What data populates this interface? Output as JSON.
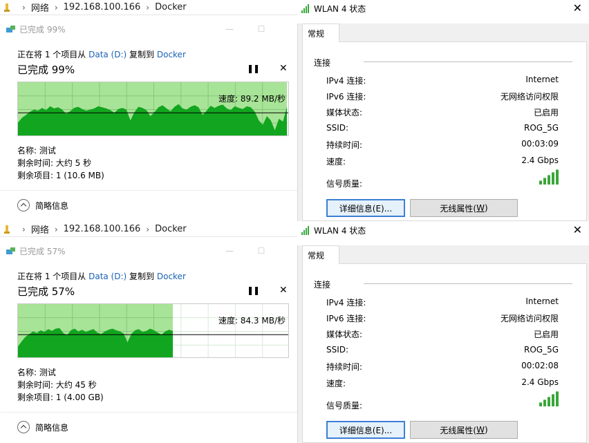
{
  "panes": [
    {
      "explorer": {
        "breadcrumb": [
          "网络",
          "192.168.100.166",
          "Docker"
        ],
        "sep": "›"
      },
      "copy": {
        "title": "已完成 99%",
        "line1_prefix": "正在将 1 个项目从 ",
        "line1_source": "Data (D:)",
        "line1_mid": " 复制到 ",
        "line1_dest": "Docker",
        "percent_text": "已完成 99%",
        "progress": 0.99,
        "pause_glyph": "❚❚",
        "close_glyph": "✕",
        "speed": "速度: 89.2 MB/秒",
        "speed_line_frac": 0.44,
        "name": "名称: 测试",
        "time_left": "剩余时间: 大约 5 秒",
        "items_left": "剩余项目: 1 (10.6 MB)",
        "less_info": "简略信息",
        "throughput": [
          0.26,
          0.35,
          0.4,
          0.46,
          0.5,
          0.48,
          0.53,
          0.49,
          0.56,
          0.52,
          0.54,
          0.5,
          0.42,
          0.47,
          0.53,
          0.55,
          0.51,
          0.48,
          0.5,
          0.52,
          0.56,
          0.54,
          0.52,
          0.49,
          0.44,
          0.51,
          0.53,
          0.5,
          0.3,
          0.45,
          0.55,
          0.53,
          0.49,
          0.38,
          0.45,
          0.54,
          0.58,
          0.52,
          0.47,
          0.55,
          0.6,
          0.52,
          0.5,
          0.55,
          0.58,
          0.54,
          0.4,
          0.48,
          0.57,
          0.53,
          0.57,
          0.59,
          0.52,
          0.49,
          0.56,
          0.53,
          0.51,
          0.56,
          0.54,
          0.46,
          0.3,
          0.22,
          0.38,
          0.3,
          0.12,
          0.33,
          0.28,
          0.55
        ]
      }
    },
    {
      "explorer": {
        "breadcrumb": [
          "网络",
          "192.168.100.166",
          "Docker"
        ],
        "sep": "›"
      },
      "copy": {
        "title": "已完成 57%",
        "line1_prefix": "正在将 1 个项目从 ",
        "line1_source": "Data (D:)",
        "line1_mid": " 复制到 ",
        "line1_dest": "Docker",
        "percent_text": "已完成 57%",
        "progress": 0.57,
        "pause_glyph": "❚❚",
        "close_glyph": "✕",
        "speed": "速度: 84.3 MB/秒",
        "speed_line_frac": 0.44,
        "name": "名称: 测试",
        "time_left": "剩余时间: 大约 45 秒",
        "items_left": "剩余项目: 1 (4.00 GB)",
        "less_info": "简略信息",
        "throughput": [
          0.22,
          0.32,
          0.4,
          0.45,
          0.5,
          0.47,
          0.52,
          0.49,
          0.54,
          0.51,
          0.55,
          0.56,
          0.47,
          0.43,
          0.52,
          0.55,
          0.5,
          0.53,
          0.49,
          0.52,
          0.54,
          0.48,
          0.45,
          0.5,
          0.53,
          0.55,
          0.52,
          0.5,
          0.46,
          0.3,
          0.45,
          0.52,
          0.54,
          0.49,
          0.51,
          0.55,
          0.52,
          0.48,
          0.44,
          0.5,
          0.53,
          0.51
        ]
      }
    }
  ],
  "wlan": [
    {
      "title": "WLAN 4 状态",
      "close_glyph": "✕",
      "tab": "常规",
      "group": "连接",
      "rows": [
        {
          "label": "IPv4 连接:",
          "value": "Internet"
        },
        {
          "label": "IPv6 连接:",
          "value": "无网络访问权限"
        },
        {
          "label": "媒体状态:",
          "value": "已启用"
        },
        {
          "label": "SSID:",
          "value": "ROG_5G"
        },
        {
          "label": "持续时间:",
          "value": "00:03:09"
        },
        {
          "label": "速度:",
          "value": "2.4 Gbps"
        }
      ],
      "signal_label": "信号质量:",
      "signal_bars": 5,
      "details_button": "详细信息(E)...",
      "wireless_button_main": "无线属性(",
      "wireless_button_key": "W",
      "wireless_button_end": ")",
      "colors": {
        "accent": "#3c7fd3",
        "signal": "#3aa63a"
      }
    },
    {
      "title": "WLAN 4 状态",
      "close_glyph": "✕",
      "tab": "常规",
      "group": "连接",
      "rows": [
        {
          "label": "IPv4 连接:",
          "value": "Internet"
        },
        {
          "label": "IPv6 连接:",
          "value": "无网络访问权限"
        },
        {
          "label": "媒体状态:",
          "value": "已启用"
        },
        {
          "label": "SSID:",
          "value": "ROG_5G"
        },
        {
          "label": "持续时间:",
          "value": "00:02:08"
        },
        {
          "label": "速度:",
          "value": "2.4 Gbps"
        }
      ],
      "signal_label": "信号质量:",
      "signal_bars": 5,
      "details_button": "详细信息(E)...",
      "wireless_button_main": "无线属性(",
      "wireless_button_key": "W",
      "wireless_button_end": ")",
      "colors": {
        "accent": "#3c7fd3",
        "signal": "#3aa63a"
      }
    }
  ],
  "colors": {
    "graph_fill": "#12a51f",
    "graph_bg_done": "#a8e497",
    "graph_grid": "#86c680",
    "graph_grid_empty": "#d6ebd3",
    "link": "#1a62b5"
  }
}
